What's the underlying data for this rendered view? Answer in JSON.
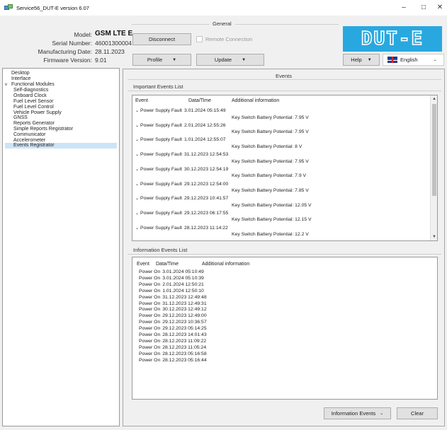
{
  "window": {
    "title": "Service56_DUT-E version 6.07",
    "minimize": "–",
    "maximize": "□",
    "close": "✕"
  },
  "device": {
    "model_label": "Model:",
    "model_value": "GSM LTE E",
    "serial_label": "Serial Number:",
    "serial_value": "46001300004",
    "mfg_label": "Manufacturing Date:",
    "mfg_value": "28.11.2023",
    "fw_label": "Firmware Version:",
    "fw_value": "9.01"
  },
  "general": {
    "legend": "General",
    "disconnect": "Disconnect",
    "remote_connection": "Remote Connection",
    "profile": "Profile",
    "update": "Update",
    "help": "Help",
    "language": "English"
  },
  "logo": {
    "text": "DUT-E",
    "color": "#29a8e0"
  },
  "sidebar": {
    "items": [
      {
        "label": "Desktop",
        "level": 0,
        "expander": ""
      },
      {
        "label": "Interface",
        "level": 0,
        "expander": ""
      },
      {
        "label": "Functional Modules",
        "level": 0,
        "expander": "v"
      },
      {
        "label": "Self-diagnostics",
        "level": 1
      },
      {
        "label": "Onboard Clock",
        "level": 1
      },
      {
        "label": "Fuel Level Sensor",
        "level": 1
      },
      {
        "label": "Fuel Level Control",
        "level": 1
      },
      {
        "label": "Vehicle Power Supply",
        "level": 1
      },
      {
        "label": "GNSS",
        "level": 1
      },
      {
        "label": "Reports Generator",
        "level": 1
      },
      {
        "label": "Simple Reports Registrator",
        "level": 1
      },
      {
        "label": "Communicator",
        "level": 1
      },
      {
        "label": "Accelerometer",
        "level": 1
      },
      {
        "label": "Events Registrator",
        "level": 1,
        "selected": true
      }
    ]
  },
  "events": {
    "title": "Events",
    "important": {
      "label": "Important Events List",
      "columns": [
        "Event",
        "Data/Time",
        "Additional information"
      ],
      "rows": [
        {
          "event": "Power Supply Fault",
          "datetime": "3.01.2024 05:15:49",
          "info": "Key Switch Battery Potential: 7.95 V"
        },
        {
          "event": "Power Supply Fault",
          "datetime": "2.01.2024 12:55:26",
          "info": "Key Switch Battery Potential: 7.95 V"
        },
        {
          "event": "Power Supply Fault",
          "datetime": "1.01.2024 12:55:07",
          "info": "Key Switch Battery Potential: 8 V"
        },
        {
          "event": "Power Supply Fault",
          "datetime": "31.12.2023 12:54:53",
          "info": "Key Switch Battery Potential: 7.95 V"
        },
        {
          "event": "Power Supply Fault",
          "datetime": "30.12.2023 12:54:19",
          "info": "Key Switch Battery Potential: 7.9 V"
        },
        {
          "event": "Power Supply Fault",
          "datetime": "29.12.2023 12:54:00",
          "info": "Key Switch Battery Potential: 7.85 V"
        },
        {
          "event": "Power Supply Fault",
          "datetime": "29.12.2023 10:41:57",
          "info": "Key Switch Battery Potential: 12.05 V"
        },
        {
          "event": "Power Supply Fault",
          "datetime": "29.12.2023 06:17:55",
          "info": "Key Switch Battery Potential: 12.15 V"
        },
        {
          "event": "Power Supply Fault",
          "datetime": "28.12.2023 11:14:22",
          "info": "Key Switch Battery Potential: 12.2 V"
        }
      ]
    },
    "information": {
      "label": "Information Events List",
      "columns": [
        "Event",
        "Data/Time",
        "Additional information"
      ],
      "rows": [
        {
          "event": "Power On",
          "datetime": "3.01.2024 05:10:49"
        },
        {
          "event": "Power On",
          "datetime": "3.01.2024 05:10:39"
        },
        {
          "event": "Power On",
          "datetime": "2.01.2024 12:50:21"
        },
        {
          "event": "Power On",
          "datetime": "1.01.2024 12:50:10"
        },
        {
          "event": "Power On",
          "datetime": "31.12.2023 12:49:48"
        },
        {
          "event": "Power On",
          "datetime": "31.12.2023 12:49:31"
        },
        {
          "event": "Power On",
          "datetime": "30.12.2023 12:49:12"
        },
        {
          "event": "Power On",
          "datetime": "29.12.2023 12:49:00"
        },
        {
          "event": "Power On",
          "datetime": "29.12.2023 10:36:57"
        },
        {
          "event": "Power On",
          "datetime": "29.12.2023 05:14:25"
        },
        {
          "event": "Power On",
          "datetime": "28.12.2023 14:01:43"
        },
        {
          "event": "Power On",
          "datetime": "28.12.2023 11:09:22"
        },
        {
          "event": "Power On",
          "datetime": "28.12.2023 11:05:24"
        },
        {
          "event": "Power On",
          "datetime": "28.12.2023 05:16:58"
        },
        {
          "event": "Power On",
          "datetime": "28.12.2023 05:16:44"
        }
      ]
    },
    "filter_select": "Information Events",
    "clear": "Clear"
  }
}
